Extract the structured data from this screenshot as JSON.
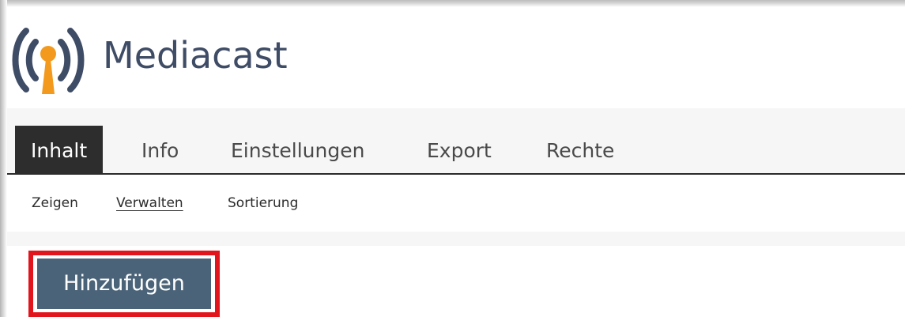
{
  "app": {
    "title": "Mediacast",
    "logo_icon": "broadcast-antenna-icon"
  },
  "tabs": [
    {
      "label": "Inhalt",
      "active": true
    },
    {
      "label": "Info",
      "active": false
    },
    {
      "label": "Einstellungen",
      "active": false
    },
    {
      "label": "Export",
      "active": false
    },
    {
      "label": "Rechte",
      "active": false
    }
  ],
  "subtabs": [
    {
      "label": "Zeigen",
      "active": false
    },
    {
      "label": "Verwalten",
      "active": true
    },
    {
      "label": "Sortierung",
      "active": false
    }
  ],
  "toolbar": {
    "add_label": "Hinzufügen"
  },
  "colors": {
    "title": "#3f4c66",
    "active_tab_bg": "#2d2d2d",
    "button_bg": "#4b6378",
    "highlight_border": "#e2141c",
    "logo_waves": "#3f4c66",
    "logo_antenna": "#f39a1e"
  }
}
